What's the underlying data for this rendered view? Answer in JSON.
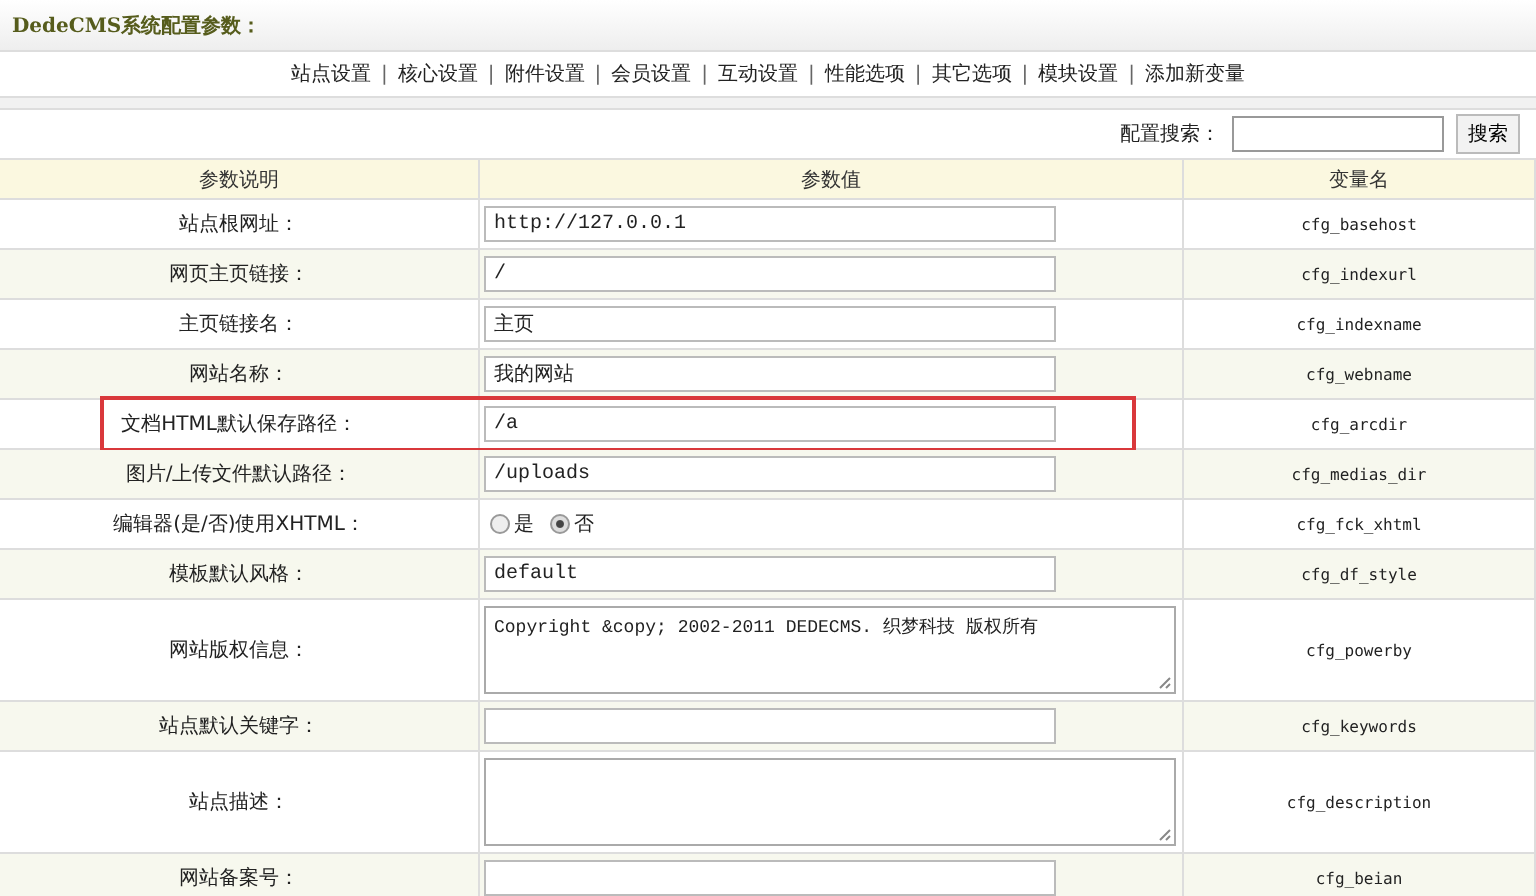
{
  "header": {
    "title": "DedeCMS系统配置参数："
  },
  "nav": [
    "站点设置",
    "核心设置",
    "附件设置",
    "会员设置",
    "互动设置",
    "性能选项",
    "其它选项",
    "模块设置",
    "添加新变量"
  ],
  "nav_separator": "|",
  "search": {
    "label": "配置搜索：",
    "button": "搜索"
  },
  "table": {
    "columns": [
      "参数说明",
      "参数值",
      "变量名"
    ],
    "rows": [
      {
        "label": "站点根网址：",
        "kind": "input",
        "value": "http://127.0.0.1",
        "variable": "cfg_basehost",
        "highlighted": false
      },
      {
        "label": "网页主页链接：",
        "kind": "input",
        "value": "/",
        "variable": "cfg_indexurl",
        "highlighted": false
      },
      {
        "label": "主页链接名：",
        "kind": "input",
        "value": "主页",
        "variable": "cfg_indexname",
        "highlighted": false
      },
      {
        "label": "网站名称：",
        "kind": "input",
        "value": "我的网站",
        "variable": "cfg_webname",
        "highlighted": false
      },
      {
        "label": "文档HTML默认保存路径：",
        "kind": "input",
        "value": "/a",
        "variable": "cfg_arcdir",
        "highlighted": true
      },
      {
        "label": "图片/上传文件默认路径：",
        "kind": "input",
        "value": "/uploads",
        "variable": "cfg_medias_dir",
        "highlighted": false
      },
      {
        "label": "编辑器(是/否)使用XHTML：",
        "kind": "radio",
        "options": [
          {
            "label": "是",
            "selected": false
          },
          {
            "label": "否",
            "selected": true
          }
        ],
        "variable": "cfg_fck_xhtml",
        "highlighted": false
      },
      {
        "label": "模板默认风格：",
        "kind": "input",
        "value": "default",
        "variable": "cfg_df_style",
        "highlighted": false
      },
      {
        "label": "网站版权信息：",
        "kind": "textarea",
        "value": "Copyright &copy; 2002-2011 DEDECMS. 织梦科技 版权所有",
        "variable": "cfg_powerby",
        "highlighted": false
      },
      {
        "label": "站点默认关键字：",
        "kind": "input",
        "variable": "cfg_keywords",
        "highlighted": false
      },
      {
        "label": "站点描述：",
        "kind": "textarea",
        "variable": "cfg_description",
        "highlighted": false
      },
      {
        "label": "网站备案号：",
        "kind": "input",
        "variable": "cfg_beian",
        "highlighted": false
      }
    ]
  }
}
